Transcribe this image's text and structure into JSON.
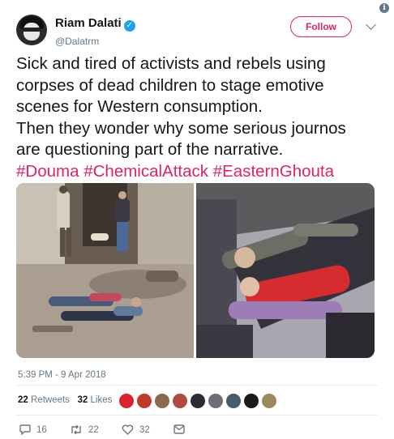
{
  "user": {
    "display_name": "Riam Dalati",
    "handle": "@Dalatrm"
  },
  "follow_label": "Follow",
  "tweet": {
    "lines": [
      "Sick and tired of activists and rebels using",
      "corpses of dead children to stage emotive",
      "scenes for Western consumption.",
      "Then they wonder why some serious journos",
      "are questioning part of the narrative."
    ],
    "hashtags": [
      "#Douma",
      "#ChemicalAttack",
      "#EasternGhouta"
    ]
  },
  "timestamp": "5:39 PM - 9 Apr 2018",
  "stats": {
    "retweets_count": "22",
    "retweets_label": "Retweets",
    "likes_count": "32",
    "likes_label": "Likes"
  },
  "actions": {
    "reply_count": "16",
    "retweet_count": "22",
    "like_count": "32"
  },
  "colors": {
    "accent": "#e0245e",
    "verified": "#1da1f2",
    "muted": "#657786"
  },
  "icons": [
    "info-icon",
    "verified-icon",
    "chevron-down-icon",
    "reply-icon",
    "retweet-icon",
    "heart-icon",
    "message-icon"
  ]
}
